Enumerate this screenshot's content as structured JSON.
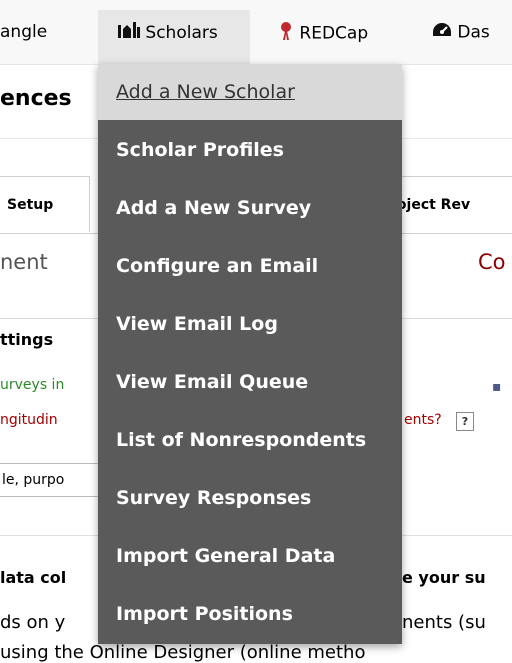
{
  "topnav": {
    "item_left": "angle",
    "scholars": "Scholars",
    "redcap": "REDCap",
    "dash": "Das"
  },
  "heading": "ences",
  "tabs": {
    "left": "Setup",
    "right": "roject Rev"
  },
  "section": {
    "title": "nent",
    "right": "Co"
  },
  "settings": {
    "title": "ttings",
    "green_text": "urveys in",
    "red_text_left": "ngitudin",
    "red_text_right": "ents?",
    "help": "?",
    "input_text": "le, purpo"
  },
  "lower": {
    "data_col": "lata col",
    "your_su": "e your su",
    "ds_on": "ds on y",
    "ments": "nents (su",
    "using": "using the Online Designer (online metho"
  },
  "dropdown": {
    "items": [
      {
        "label": "Add a New Scholar",
        "active": true
      },
      {
        "label": "Scholar Profiles"
      },
      {
        "label": "Add a New Survey"
      },
      {
        "label": "Configure an Email"
      },
      {
        "label": "View Email Log"
      },
      {
        "label": "View Email Queue"
      },
      {
        "label": "List of Nonrespondents"
      },
      {
        "label": "Survey Responses"
      },
      {
        "label": "Import General Data"
      },
      {
        "label": "Import Positions"
      }
    ]
  },
  "colors": {
    "dropdown_bg": "#5a5a5a",
    "active_item_bg": "#d9d9d9",
    "redcap_icon": "#c0282d",
    "green_text": "#2b8a2b",
    "red_text": "#a50000"
  }
}
